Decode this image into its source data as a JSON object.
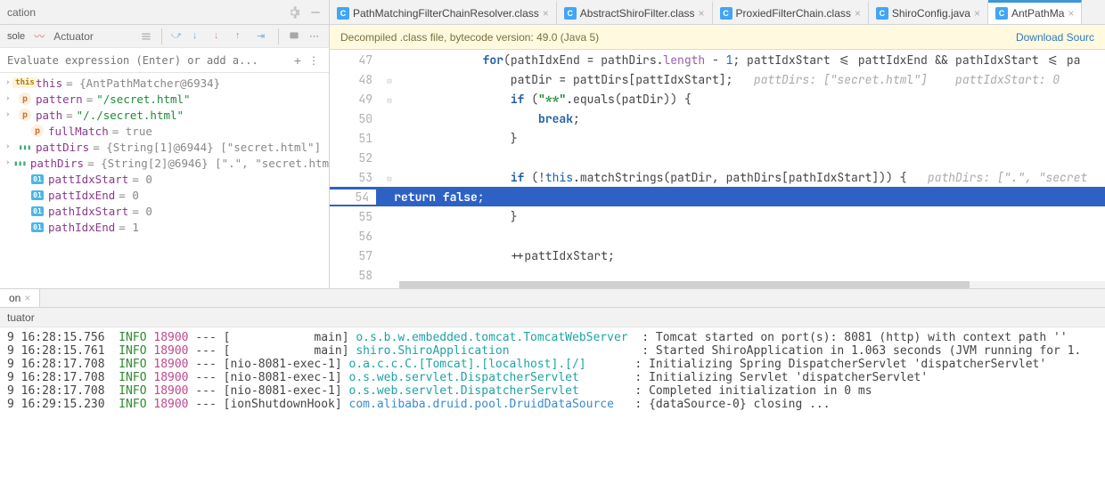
{
  "debug_panel": {
    "title_suffix": "cation",
    "actuator_label": "Actuator",
    "eval_placeholder": "Evaluate expression (Enter) or add a...",
    "vars": [
      {
        "icon": "this",
        "name": "this",
        "rest": " = {AntPathMatcher@6934}",
        "expandable": true
      },
      {
        "icon": "p",
        "name": "pattern",
        "rest": " = ",
        "value": "\"/secret.html\"",
        "expandable": true
      },
      {
        "icon": "p",
        "name": "path",
        "rest": " = ",
        "value": "\"/./secret.html\"",
        "expandable": true
      },
      {
        "icon": "p",
        "name": "fullMatch",
        "rest": " = true",
        "indent": 1
      },
      {
        "icon": "arr",
        "name": "pattDirs",
        "rest": " = {String[1]@6944} [\"secret.html\"]",
        "expandable": true
      },
      {
        "icon": "arr",
        "name": "pathDirs",
        "rest": " = {String[2]@6946} [\".\", \"secret.html\"]",
        "expandable": true
      },
      {
        "icon": "01",
        "name": "pattIdxStart",
        "rest": " = 0",
        "indent": 1
      },
      {
        "icon": "01",
        "name": "pattIdxEnd",
        "rest": " = 0",
        "indent": 1
      },
      {
        "icon": "01",
        "name": "pathIdxStart",
        "rest": " = 0",
        "indent": 1
      },
      {
        "icon": "01",
        "name": "pathIdxEnd",
        "rest": " = 1",
        "indent": 1
      }
    ]
  },
  "tabs": [
    {
      "icon": "c",
      "label": "PathMatchingFilterChainResolver.class",
      "active": false
    },
    {
      "icon": "c",
      "label": "AbstractShiroFilter.class",
      "active": false
    },
    {
      "icon": "c",
      "label": "ProxiedFilterChain.class",
      "active": false
    },
    {
      "icon": "c",
      "label": "ShiroConfig.java",
      "active": false
    },
    {
      "icon": "c",
      "label": "AntPathMa",
      "active": true
    }
  ],
  "banner": {
    "text": "Decompiled .class file, bytecode version: 49.0 (Java 5)",
    "link": "Download Sourc"
  },
  "code": {
    "lines": [
      {
        "n": 47,
        "html": "            <span class='kw'>for</span>(pathIdxEnd = pathDirs.<span class='prop'>length</span> - <span class='num'>1</span>; pattIdxStart <= pattIdxEnd && pathIdxStart <= pa"
      },
      {
        "n": 48,
        "html": "                patDir = pattDirs[pattIdxStart];   <span class='cmt'>pattDirs: [\"secret.html\"]    pattIdxStart: 0</span>",
        "fold": true
      },
      {
        "n": 49,
        "html": "                <span class='kw'>if</span> (<span class='strg'>\"**\"</span>.equals(patDir)) {",
        "fold": true
      },
      {
        "n": 50,
        "html": "                    <span class='kw'>break</span>;"
      },
      {
        "n": 51,
        "html": "                }"
      },
      {
        "n": 52,
        "html": ""
      },
      {
        "n": 53,
        "html": "                <span class='kw'>if</span> (!<span class='th'>this</span>.matchStrings(patDir, pathDirs[pathIdxStart])) {   <span class='cmt'>pathDirs: [\".\", \"secret</span>",
        "fold": true
      },
      {
        "n": 54,
        "html": "                    <span class='kw'>return false</span>;",
        "hl": true
      },
      {
        "n": 55,
        "html": "                }"
      },
      {
        "n": 56,
        "html": ""
      },
      {
        "n": 57,
        "html": "                ++pattIdxStart;"
      },
      {
        "n": 58,
        "html": "            ⁠"
      }
    ]
  },
  "bottom_tab": {
    "label": "on"
  },
  "console": {
    "header": "tuator",
    "rows": [
      {
        "t": "9 16:28:15.756",
        "lvl": "INFO",
        "pid": "18900",
        "th": "[            main]",
        "src": "o.s.b.w.embedded.tomcat.TomcatWebServer",
        "msg": "Tomcat started on port(s): 8081 (http) with context path ''"
      },
      {
        "t": "9 16:28:15.761",
        "lvl": "INFO",
        "pid": "18900",
        "th": "[            main]",
        "src": "shiro.ShiroApplication",
        "msg": "Started ShiroApplication in 1.063 seconds (JVM running for 1."
      },
      {
        "t": "9 16:28:17.708",
        "lvl": "INFO",
        "pid": "18900",
        "th": "[nio-8081-exec-1]",
        "src": "o.a.c.c.C.[Tomcat].[localhost].[/]",
        "msg": "Initializing Spring DispatcherServlet 'dispatcherServlet'"
      },
      {
        "t": "9 16:28:17.708",
        "lvl": "INFO",
        "pid": "18900",
        "th": "[nio-8081-exec-1]",
        "src": "o.s.web.servlet.DispatcherServlet",
        "msg": "Initializing Servlet 'dispatcherServlet'"
      },
      {
        "t": "9 16:28:17.708",
        "lvl": "INFO",
        "pid": "18900",
        "th": "[nio-8081-exec-1]",
        "src": "o.s.web.servlet.DispatcherServlet",
        "msg": "Completed initialization in 0 ms"
      },
      {
        "t": "9 16:29:15.230",
        "lvl": "INFO",
        "pid": "18900",
        "th": "[ionShutdownHook]",
        "src": "com.alibaba.druid.pool.DruidDataSource",
        "src_alt": true,
        "msg": "{dataSource-0} closing ..."
      }
    ]
  }
}
